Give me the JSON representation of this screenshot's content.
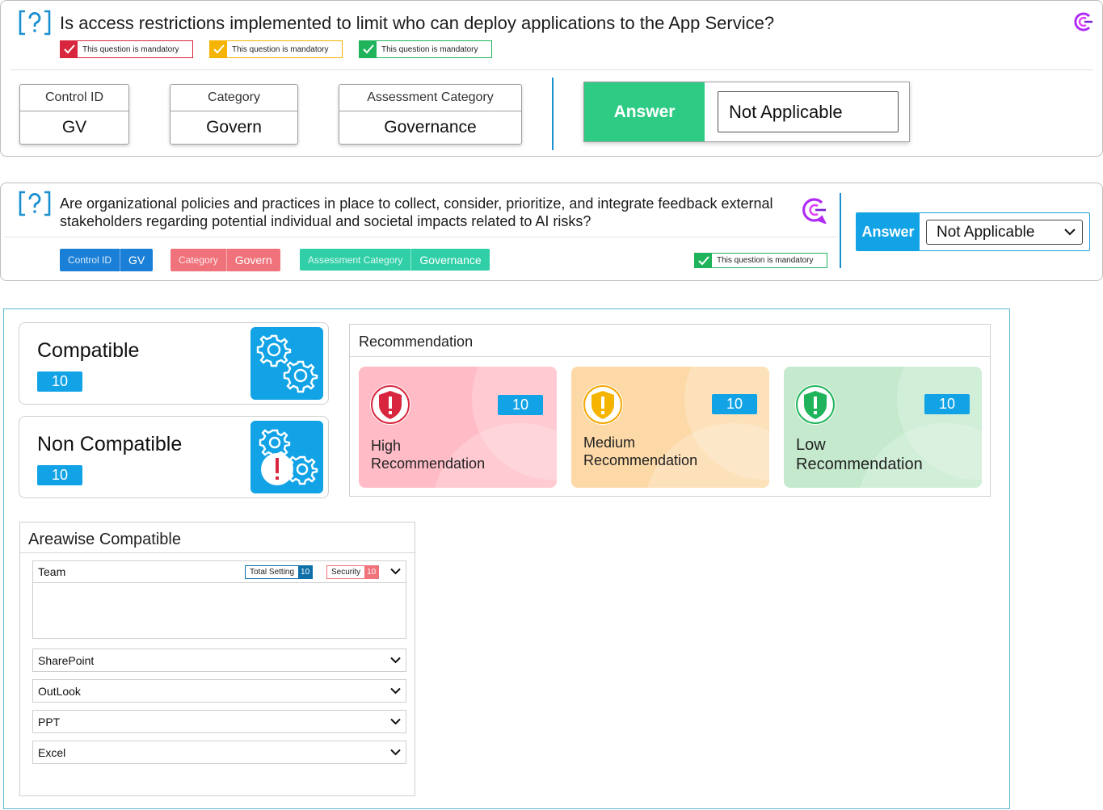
{
  "question1": {
    "title": "Is access restrictions implemented to limit who can deploy applications to the App Service?",
    "mandatory_tags": [
      {
        "label": "This question is mandatory",
        "color": "#d7263d"
      },
      {
        "label": "This question is mandatory",
        "color": "#f4b400"
      },
      {
        "label": "This question is mandatory",
        "color": "#1fb45b"
      }
    ],
    "control_id_label": "Control ID",
    "control_id_value": "GV",
    "category_label": "Category",
    "category_value": "Govern",
    "assessment_category_label": "Assessment Category",
    "assessment_category_value": "Governance",
    "answer_label": "Answer",
    "answer_value": "Not Applicable"
  },
  "question2": {
    "title": "Are organizational policies and practices in place to collect, consider, prioritize, and integrate feedback external stakeholders regarding potential individual and societal impacts related to AI risks?",
    "control_id_label": "Control ID",
    "control_id_value": "GV",
    "category_label": "Category",
    "category_value": "Govern",
    "assessment_category_label": "Assessment Category",
    "assessment_category_value": "Governance",
    "mandatory_label": "This question is mandatory",
    "answer_label": "Answer",
    "answer_value": "Not Applicable"
  },
  "compatibility": {
    "compatible_label": "Compatible",
    "compatible_count": "10",
    "non_compatible_label": "Non Compatible",
    "non_compatible_count": "10"
  },
  "recommendation": {
    "title": "Recommendation",
    "high": {
      "line1": "High",
      "line2": "Recommendation",
      "count": "10",
      "color": "#ffbcc6"
    },
    "medium": {
      "line1": "Medium",
      "line2": "Recommendation",
      "count": "10",
      "color": "#fdd9a7"
    },
    "low": {
      "line1": "Low",
      "line2": "Recommendation",
      "count": "10",
      "color": "#c4e9cd"
    }
  },
  "areawise": {
    "title": "Areawise Compatible",
    "team": {
      "label": "Team",
      "total_setting_label": "Total Setting",
      "total_setting_value": "10",
      "security_label": "Security",
      "security_value": "10"
    },
    "areas": [
      "SharePoint",
      "OutLook",
      "PPT",
      "Excel"
    ]
  },
  "colors": {
    "accent_blue": "#12a3e6",
    "answer_green": "#2ecb84",
    "brand_purple": "#a020f0"
  }
}
